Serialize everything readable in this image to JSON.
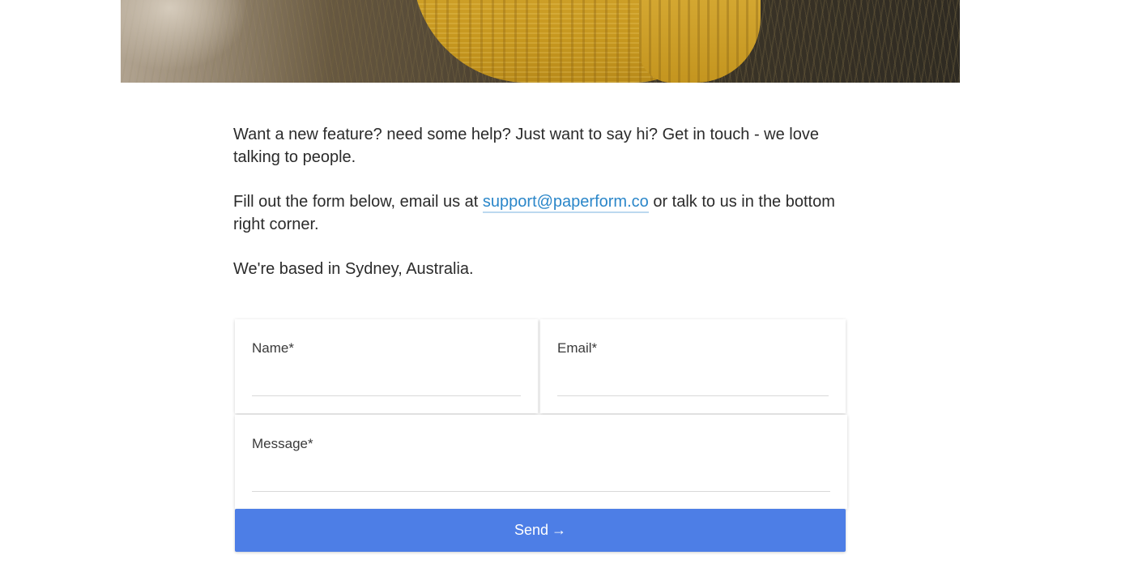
{
  "hero": {
    "image_alt": "person in mustard knit sweater in field"
  },
  "intro": {
    "paragraph1": "Want a new feature? need some help? Just want to say hi? Get in touch - we love talking to people.",
    "paragraph2_before": "Fill out the form below, email us at ",
    "email_link": "support@paperform.co",
    "paragraph2_after": " or talk to us in the bottom right corner.",
    "paragraph3": "We're based in Sydney, Australia."
  },
  "form": {
    "name_label": "Name*",
    "name_value": "",
    "email_label": "Email*",
    "email_value": "",
    "message_label": "Message*",
    "message_value": "",
    "send_label": "Send",
    "send_arrow": "→"
  },
  "colors": {
    "link": "#2a86c9",
    "button": "#4d7ee6",
    "text": "#2b2b2b"
  }
}
